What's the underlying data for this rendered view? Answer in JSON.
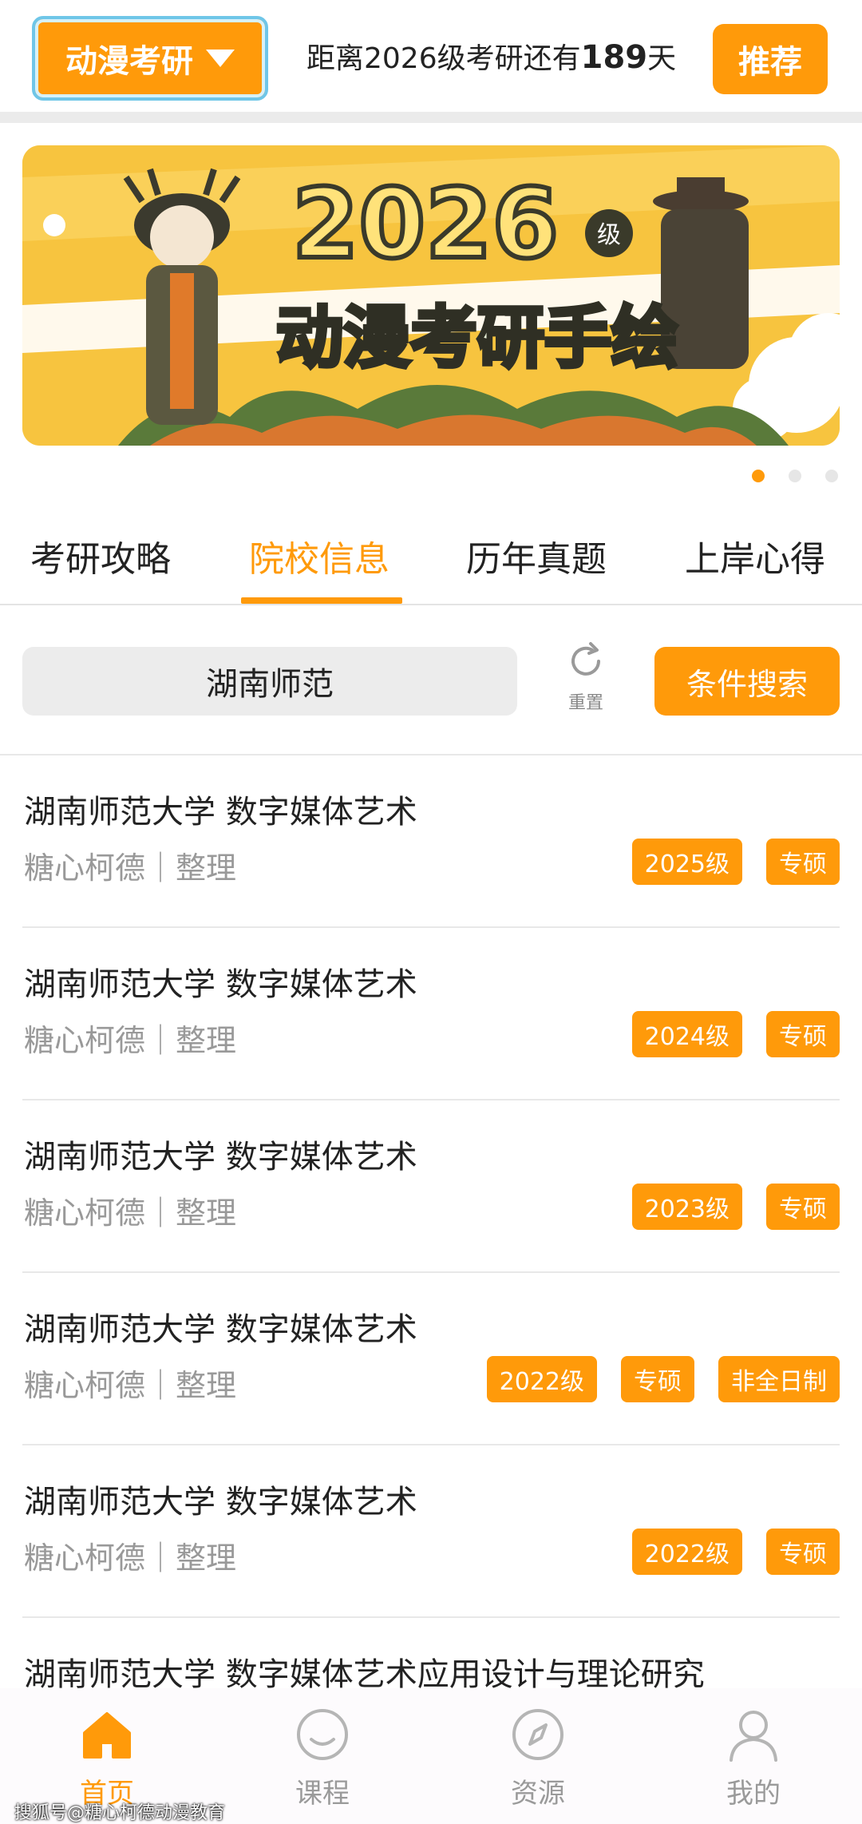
{
  "header": {
    "category_label": "动漫考研",
    "countdown_prefix": "距离2026级考研还有",
    "countdown_days": "189",
    "countdown_suffix": "天",
    "recommend_label": "推荐"
  },
  "banner": {
    "year_text": "2026",
    "grade_badge": "级",
    "title": "动漫考研手绘",
    "active_index": 0,
    "dot_count": 3
  },
  "tabs": [
    {
      "label": "考研攻略",
      "active": false
    },
    {
      "label": "院校信息",
      "active": true
    },
    {
      "label": "历年真题",
      "active": false
    },
    {
      "label": "上岸心得",
      "active": false
    }
  ],
  "search": {
    "value": "湖南师范",
    "reset_label": "重置",
    "condition_search_label": "条件搜索"
  },
  "list": [
    {
      "title": "湖南师范大学 数字媒体艺术",
      "meta": "糖心柯德｜整理",
      "tags": [
        "2025级",
        "专硕"
      ]
    },
    {
      "title": "湖南师范大学 数字媒体艺术",
      "meta": "糖心柯德｜整理",
      "tags": [
        "2024级",
        "专硕"
      ]
    },
    {
      "title": "湖南师范大学 数字媒体艺术",
      "meta": "糖心柯德｜整理",
      "tags": [
        "2023级",
        "专硕"
      ]
    },
    {
      "title": "湖南师范大学  数字媒体艺术",
      "meta": "糖心柯德｜整理",
      "tags": [
        "2022级",
        "专硕",
        "非全日制"
      ]
    },
    {
      "title": "湖南师范大学  数字媒体艺术",
      "meta": "糖心柯德｜整理",
      "tags": [
        "2022级",
        "专硕"
      ]
    },
    {
      "title": "湖南师范大学  数字媒体艺术应用设计与理论研究",
      "meta": "",
      "tags": []
    }
  ],
  "bottom_nav": [
    {
      "label": "首页",
      "icon": "home-icon",
      "active": true
    },
    {
      "label": "课程",
      "icon": "smile-icon",
      "active": false
    },
    {
      "label": "资源",
      "icon": "compass-icon",
      "active": false
    },
    {
      "label": "我的",
      "icon": "user-icon",
      "active": false
    }
  ],
  "watermark": "搜狐号@糖心柯德动漫教育",
  "colors": {
    "accent": "#ff9a0a",
    "muted": "#999999",
    "banner_bg": "#f7c43f"
  }
}
